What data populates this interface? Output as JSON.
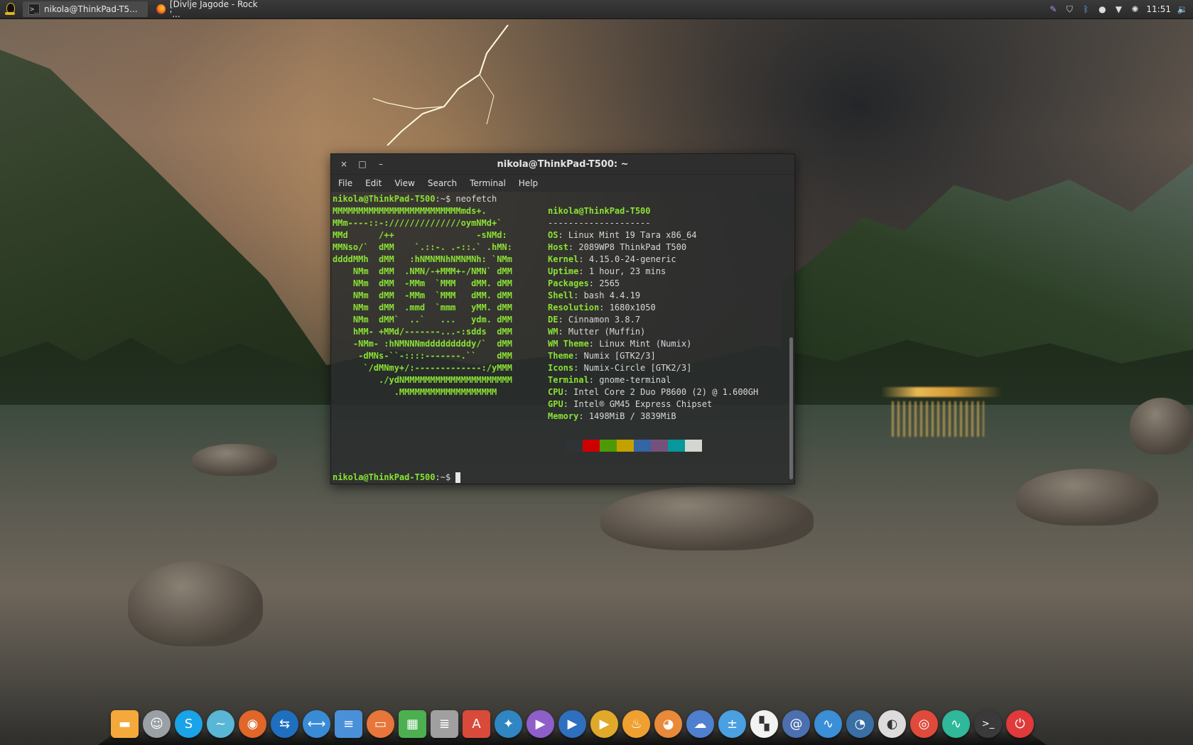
{
  "top_panel": {
    "tasks": [
      {
        "title": "nikola@ThinkPad-T5...",
        "icon": "terminal-icon"
      },
      {
        "title": "[Divlje Jagode - Rock '...",
        "icon": "firefox-icon"
      }
    ],
    "tray_icons": [
      "feather-icon",
      "shield-icon",
      "bluetooth-icon",
      "user-icon",
      "wifi-icon",
      "brightness-icon"
    ],
    "clock": "11:51",
    "volume_icon": "speaker-icon"
  },
  "terminal": {
    "title": "nikola@ThinkPad-T500: ~",
    "controls": {
      "close": "×",
      "maximize": "□",
      "minimize": "–"
    },
    "menu": [
      "File",
      "Edit",
      "View",
      "Search",
      "Terminal",
      "Help"
    ],
    "command_prompt": "nikola@ThinkPad-T500",
    "prompt_suffix": ":~$ ",
    "command": "neofetch",
    "logo_lines": [
      "MMMMMMMMMMMMMMMMMMMMMMMMMmds+.",
      "MMm----::-://////////////oymNMd+`",
      "MMd      /++                -sNMd:",
      "MMNso/`  dMM    `.::-. .-::.` .hMN:",
      "ddddMMh  dMM   :hNMNMNhNMNMNh: `NMm",
      "    NMm  dMM  .NMN/-+MMM+-/NMN` dMM",
      "    NMm  dMM  -MMm  `MMM   dMM. dMM",
      "    NMm  dMM  -MMm  `MMM   dMM. dMM",
      "    NMm  dMM  .mmd  `mmm   yMM. dMM",
      "    NMm  dMM`  ..`   ...   ydm. dMM",
      "    hMM- +MMd/-------...-:sdds  dMM",
      "    -NMm- :hNMNNNmdddddddddy/`  dMM",
      "     -dMNs-``-::::-------.``    dMM",
      "      `/dMNmy+/:-------------:/yMMM",
      "         ./ydNMMMMMMMMMMMMMMMMMMMMM",
      "            .MMMMMMMMMMMMMMMMMMM"
    ],
    "user_host": "nikola@ThinkPad-T500",
    "separator": "--------------------",
    "info": [
      {
        "key": "OS",
        "value": " Linux Mint 19 Tara x86_64"
      },
      {
        "key": "Host",
        "value": " 2089WP8 ThinkPad T500"
      },
      {
        "key": "Kernel",
        "value": " 4.15.0-24-generic"
      },
      {
        "key": "Uptime",
        "value": " 1 hour, 23 mins"
      },
      {
        "key": "Packages",
        "value": " 2565"
      },
      {
        "key": "Shell",
        "value": " bash 4.4.19"
      },
      {
        "key": "Resolution",
        "value": " 1680x1050"
      },
      {
        "key": "DE",
        "value": " Cinnamon 3.8.7"
      },
      {
        "key": "WM",
        "value": " Mutter (Muffin)"
      },
      {
        "key": "WM Theme",
        "value": " Linux Mint (Numix)"
      },
      {
        "key": "Theme",
        "value": " Numix [GTK2/3]"
      },
      {
        "key": "Icons",
        "value": " Numix-Circle [GTK2/3]"
      },
      {
        "key": "Terminal",
        "value": " gnome-terminal"
      },
      {
        "key": "CPU",
        "value": " Intel Core 2 Duo P8600 (2) @ 1.600GH"
      },
      {
        "key": "GPU",
        "value": " Intel® GM45 Express Chipset"
      },
      {
        "key": "Memory",
        "value": " 1498MiB / 3839MiB"
      }
    ],
    "color_swatches": [
      "#2e3436",
      "#cc0000",
      "#4e9a06",
      "#c4a000",
      "#3465a4",
      "#75507b",
      "#06989a",
      "#d3d7cf"
    ]
  },
  "dock": {
    "apps": [
      {
        "name": "files",
        "icon": "folder-icon",
        "color": "#f4a93a",
        "glyph": "▬"
      },
      {
        "name": "pidgin",
        "icon": "pidgin-icon",
        "color": "#9aa0a6",
        "glyph": "☺"
      },
      {
        "name": "skype",
        "icon": "skype-icon",
        "color": "#1aa3e8",
        "glyph": "S"
      },
      {
        "name": "messenger",
        "icon": "messenger-icon",
        "color": "#5ab6d6",
        "glyph": "~"
      },
      {
        "name": "firefox",
        "icon": "firefox-icon",
        "color": "#e0662a",
        "glyph": "◉"
      },
      {
        "name": "teamviewer-like",
        "icon": "remote-icon",
        "color": "#1f6fc1",
        "glyph": "⇆"
      },
      {
        "name": "teamviewer",
        "icon": "teamviewer-icon",
        "color": "#3a8bd6",
        "glyph": "⟷"
      },
      {
        "name": "documents",
        "icon": "document-icon",
        "color": "#4a90d9",
        "glyph": "≡"
      },
      {
        "name": "impress",
        "icon": "presentation-icon",
        "color": "#e8763a",
        "glyph": "▭"
      },
      {
        "name": "calc",
        "icon": "spreadsheet-icon",
        "color": "#4caf50",
        "glyph": "▦"
      },
      {
        "name": "writer",
        "icon": "writer-icon",
        "color": "#a0a0a0",
        "glyph": "≣"
      },
      {
        "name": "pdf",
        "icon": "pdf-icon",
        "color": "#d94a3a",
        "glyph": "A"
      },
      {
        "name": "kodi",
        "icon": "kodi-icon",
        "color": "#2f86c3",
        "glyph": "✦"
      },
      {
        "name": "media-player",
        "icon": "play-icon",
        "color": "#8e5fc9",
        "glyph": "▶"
      },
      {
        "name": "video-player",
        "icon": "video-play-icon",
        "color": "#2f6fbf",
        "glyph": "▶"
      },
      {
        "name": "plex",
        "icon": "plex-icon",
        "color": "#e0a92a",
        "glyph": "▶"
      },
      {
        "name": "brasero",
        "icon": "flame-icon",
        "color": "#f0a030",
        "glyph": "♨"
      },
      {
        "name": "gimp",
        "icon": "gimp-icon",
        "color": "#e88a3a",
        "glyph": "◕"
      },
      {
        "name": "cloud",
        "icon": "cloud-icon",
        "color": "#4f7fcf",
        "glyph": "☁"
      },
      {
        "name": "calculator",
        "icon": "calculator-icon",
        "color": "#4aa0e0",
        "glyph": "±"
      },
      {
        "name": "software",
        "icon": "apps-grid-icon",
        "color": "#f2f2f2",
        "glyph": "▚"
      },
      {
        "name": "steam-like",
        "icon": "swirl-icon",
        "color": "#4c6fb0",
        "glyph": "@"
      },
      {
        "name": "system-monitor",
        "icon": "monitor-icon",
        "color": "#3a8fd6",
        "glyph": "∿"
      },
      {
        "name": "disk-usage",
        "icon": "pie-icon",
        "color": "#3a6fa6",
        "glyph": "◔"
      },
      {
        "name": "settings-toggle",
        "icon": "toggle-icon",
        "color": "#dcdcdc",
        "glyph": "◐"
      },
      {
        "name": "chrome",
        "icon": "chrome-icon",
        "color": "#e04a3a",
        "glyph": "◎"
      },
      {
        "name": "activity",
        "icon": "pulse-icon",
        "color": "#2fb89a",
        "glyph": "∿"
      },
      {
        "name": "terminal",
        "icon": "terminal-icon",
        "color": "#3a3a3a",
        "glyph": ">_"
      },
      {
        "name": "power",
        "icon": "power-icon",
        "color": "#e03a3a",
        "glyph": "⏻"
      }
    ]
  }
}
